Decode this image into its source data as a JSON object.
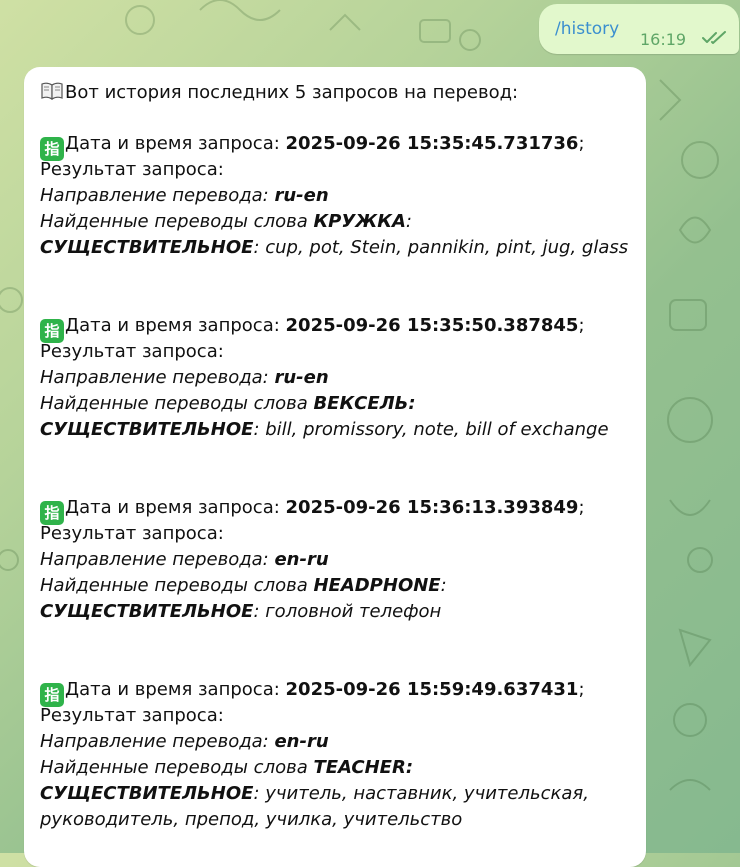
{
  "outgoing": {
    "command": "/history",
    "time": "16:19",
    "status_icon": "double-check-icon"
  },
  "incoming": {
    "header": "Вот история последних 5 запросов на перевод:",
    "header_icon": "open-book-emoji",
    "entry_icon": "finger-ideograph-emoji",
    "labels": {
      "datetime": "Дата и время запроса: ",
      "result": "Результат запроса:",
      "direction": "Направление перевода: ",
      "found": "Найденные переводы слова ",
      "pos": "СУЩЕСТВИТЕЛЬНОЕ",
      "colon": ":",
      "semicolon": ";"
    },
    "entries": [
      {
        "timestamp": "2025-09-26 15:35:45.731736",
        "direction": "ru-en",
        "word": "КРУЖКА",
        "translations": ": cup, pot, Stein, pannikin, pint, jug, glass"
      },
      {
        "timestamp": "2025-09-26 15:35:50.387845",
        "direction": "ru-en",
        "word": "ВЕКСЕЛЬ:",
        "translations": ": bill, promissory, note, bill of exchange"
      },
      {
        "timestamp": "2025-09-26 15:36:13.393849",
        "direction": "en-ru",
        "word": "HEADPHONE",
        "translations": ": головной телефон"
      },
      {
        "timestamp": "2025-09-26 15:59:49.637431",
        "direction": "en-ru",
        "word": "TEACHER:",
        "translations": ": учитель, наставник, учительская,",
        "translations_cont": "руководитель, препод, училка, учительство"
      }
    ]
  }
}
